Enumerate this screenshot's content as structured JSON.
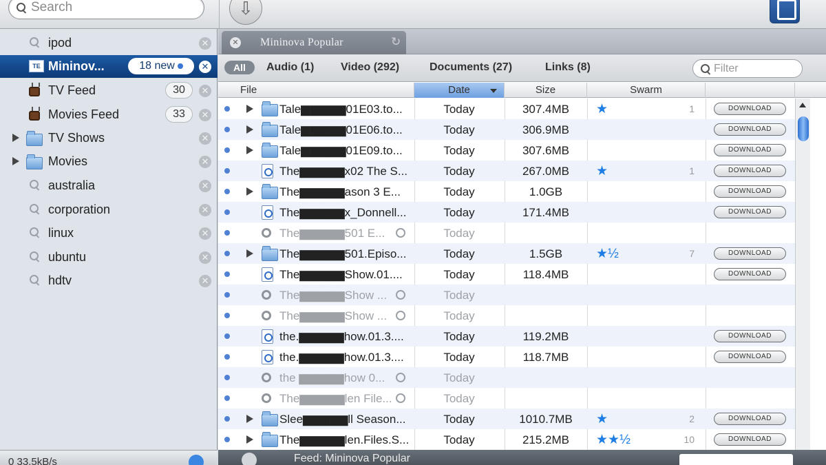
{
  "toolbar": {
    "search_placeholder": "Search",
    "download_icon": "down-arrow-icon"
  },
  "sidebar": {
    "items": [
      {
        "label": "ipod",
        "type": "search"
      },
      {
        "label": "Mininov...",
        "type": "feed",
        "badge": "18 new",
        "selected": true
      },
      {
        "label": "TV Feed",
        "type": "tv",
        "count": "30"
      },
      {
        "label": "Movies Feed",
        "type": "tv",
        "count": "33"
      },
      {
        "label": "TV Shows",
        "type": "folder"
      },
      {
        "label": "Movies",
        "type": "folder"
      },
      {
        "label": "australia",
        "type": "search"
      },
      {
        "label": "corporation",
        "type": "search"
      },
      {
        "label": "linux",
        "type": "search"
      },
      {
        "label": "ubuntu",
        "type": "search"
      },
      {
        "label": "hdtv",
        "type": "search"
      }
    ],
    "footer_rate": "0 33.5kB/s"
  },
  "main": {
    "tab_label": "Mininova Popular",
    "filters": [
      "All",
      "Audio (1)",
      "Video (292)",
      "Documents (27)",
      "Links (8)"
    ],
    "filter_placeholder": "Filter",
    "columns": [
      "File",
      "Date",
      "Size",
      "Swarm"
    ],
    "download_label": "DOWNLOAD",
    "rows": [
      {
        "name": "Tale▆▆▆▆▆01E03.to...",
        "date": "Today",
        "size": "307.4MB",
        "stars": "★",
        "seeds": "1",
        "kind": "folder",
        "download": true
      },
      {
        "name": "Tale▆▆▆▆▆01E06.to...",
        "date": "Today",
        "size": "306.9MB",
        "stars": "",
        "seeds": "",
        "kind": "folder",
        "download": true
      },
      {
        "name": "Tale▆▆▆▆▆01E09.to...",
        "date": "Today",
        "size": "307.6MB",
        "stars": "",
        "seeds": "",
        "kind": "folder",
        "download": true
      },
      {
        "name": "The▆▆▆▆▆x02 The S...",
        "date": "Today",
        "size": "267.0MB",
        "stars": "★",
        "seeds": "1",
        "kind": "audio",
        "download": true
      },
      {
        "name": "The▆▆▆▆▆ason 3 E...",
        "date": "Today",
        "size": "1.0GB",
        "stars": "",
        "seeds": "",
        "kind": "folder",
        "download": true
      },
      {
        "name": "The▆▆▆▆▆x_Donnell...",
        "date": "Today",
        "size": "171.4MB",
        "stars": "",
        "seeds": "",
        "kind": "doc",
        "download": true
      },
      {
        "name": "The▆▆▆▆▆501 E...",
        "date": "Today",
        "size": "",
        "stars": "",
        "seeds": "",
        "kind": "pending",
        "download": false
      },
      {
        "name": "The▆▆▆▆▆501.Episo...",
        "date": "Today",
        "size": "1.5GB",
        "stars": "★½",
        "seeds": "7",
        "kind": "folder",
        "download": true
      },
      {
        "name": "The▆▆▆▆▆Show.01....",
        "date": "Today",
        "size": "118.4MB",
        "stars": "",
        "seeds": "",
        "kind": "doc",
        "download": true
      },
      {
        "name": "The▆▆▆▆▆Show ...",
        "date": "Today",
        "size": "",
        "stars": "",
        "seeds": "",
        "kind": "pending",
        "download": false
      },
      {
        "name": "The▆▆▆▆▆Show ...",
        "date": "Today",
        "size": "",
        "stars": "",
        "seeds": "",
        "kind": "pending",
        "download": false
      },
      {
        "name": "the.▆▆▆▆▆how.01.3....",
        "date": "Today",
        "size": "119.2MB",
        "stars": "",
        "seeds": "",
        "kind": "doc",
        "download": true
      },
      {
        "name": "the.▆▆▆▆▆how.01.3....",
        "date": "Today",
        "size": "118.7MB",
        "stars": "",
        "seeds": "",
        "kind": "doc",
        "download": true
      },
      {
        "name": "the ▆▆▆▆▆how 0...",
        "date": "Today",
        "size": "",
        "stars": "",
        "seeds": "",
        "kind": "pending",
        "download": false
      },
      {
        "name": "The▆▆▆▆▆len File...",
        "date": "Today",
        "size": "",
        "stars": "",
        "seeds": "",
        "kind": "pending",
        "download": false
      },
      {
        "name": "Slee▆▆▆▆▆ll Season...",
        "date": "Today",
        "size": "1010.7MB",
        "stars": "★",
        "seeds": "2",
        "kind": "folder",
        "download": true
      },
      {
        "name": "The▆▆▆▆▆len.Files.S...",
        "date": "Today",
        "size": "215.2MB",
        "stars": "★★½",
        "seeds": "10",
        "kind": "folder",
        "download": true
      }
    ],
    "status_text": "Feed: Mininova Popular"
  },
  "colors": {
    "selection": "#0c3b78",
    "accent": "#1f7ee6",
    "sidebar_bg": "#dfe4ea"
  }
}
